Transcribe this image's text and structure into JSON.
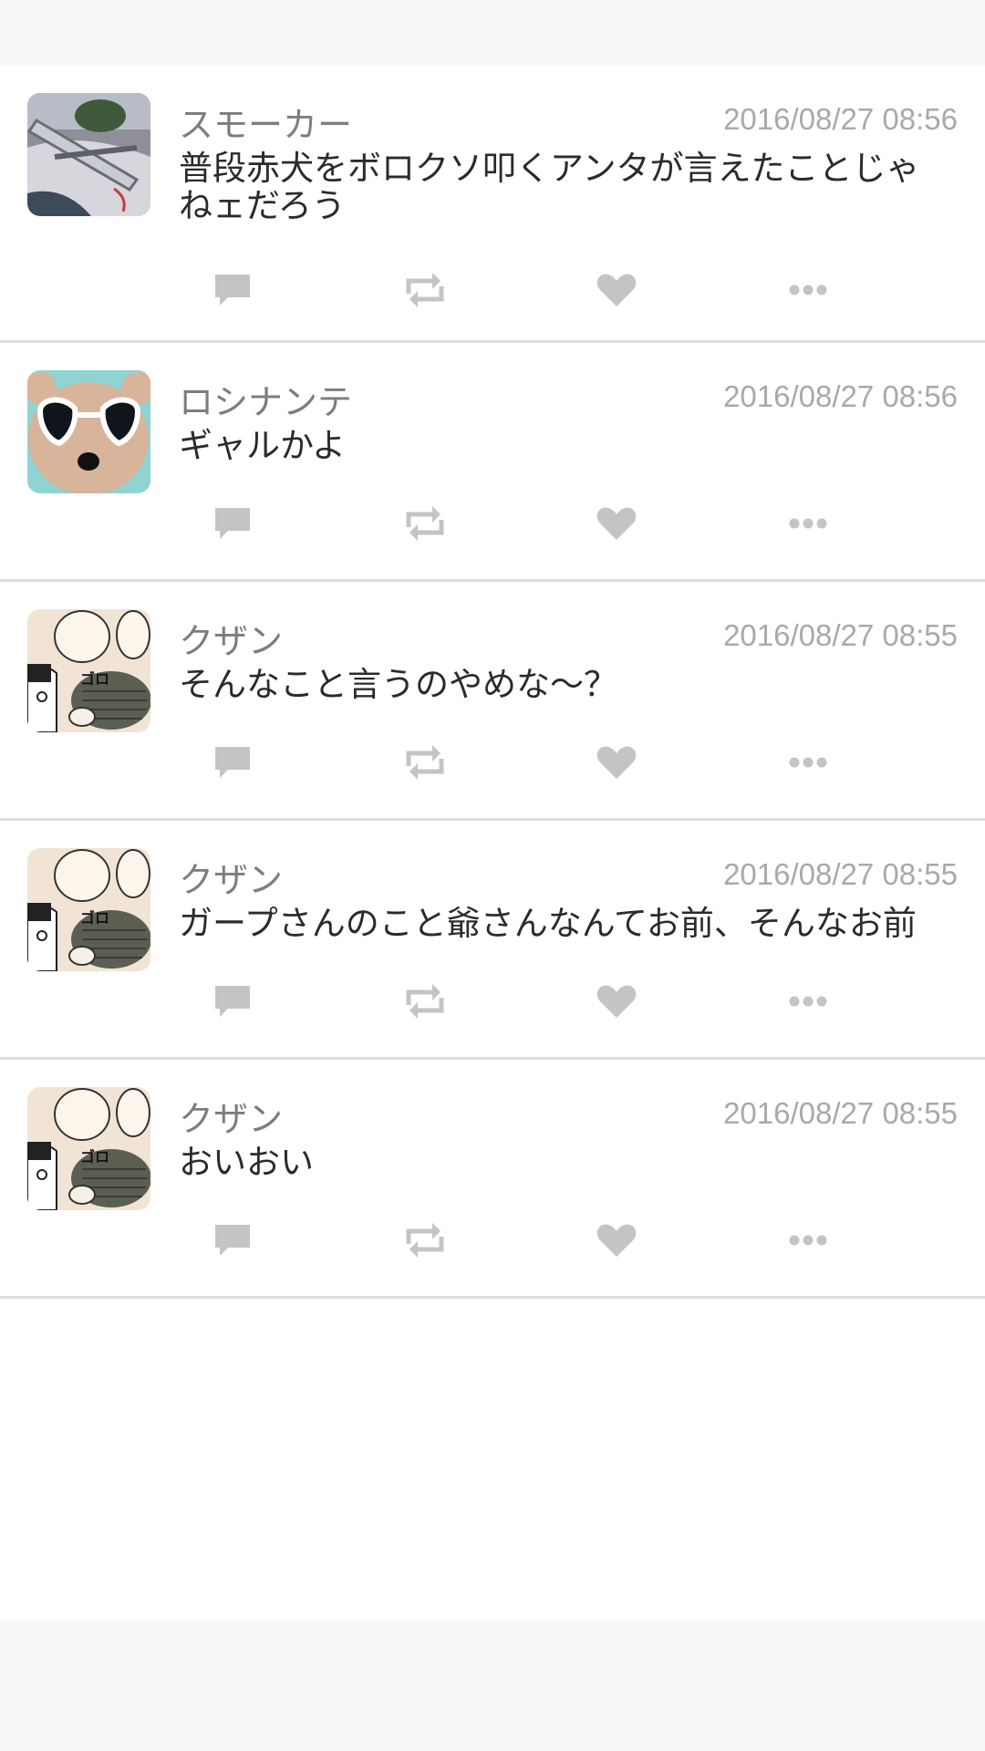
{
  "colors": {
    "background": "#f8f8f8",
    "feed_background": "#ffffff",
    "divider": "#dedede",
    "username": "#7d7d7d",
    "timestamp": "#a9a9a9",
    "message": "#2b2b2b",
    "action_icon": "#c4c4c4"
  },
  "action_icons": [
    "reply-icon",
    "retweet-icon",
    "like-icon",
    "more-icon"
  ],
  "posts": [
    {
      "avatar": "smoker-avatar",
      "username": "スモーカー",
      "timestamp": "2016/08/27 08:56",
      "message": "普段赤犬をボロクソ叩くアンタが言えたことじゃねェだろう"
    },
    {
      "avatar": "rosinante-avatar",
      "username": "ロシナンテ",
      "timestamp": "2016/08/27 08:56",
      "message": "ギャルかよ"
    },
    {
      "avatar": "kuzan-avatar",
      "username": "クザン",
      "timestamp": "2016/08/27 08:55",
      "message": "そんなこと言うのやめな～？"
    },
    {
      "avatar": "kuzan-avatar",
      "username": "クザン",
      "timestamp": "2016/08/27 08:55",
      "message": "ガープさんのこと爺さんなんてお前、そんなお前"
    },
    {
      "avatar": "kuzan-avatar",
      "username": "クザン",
      "timestamp": "2016/08/27 08:55",
      "message": "おいおい"
    }
  ]
}
